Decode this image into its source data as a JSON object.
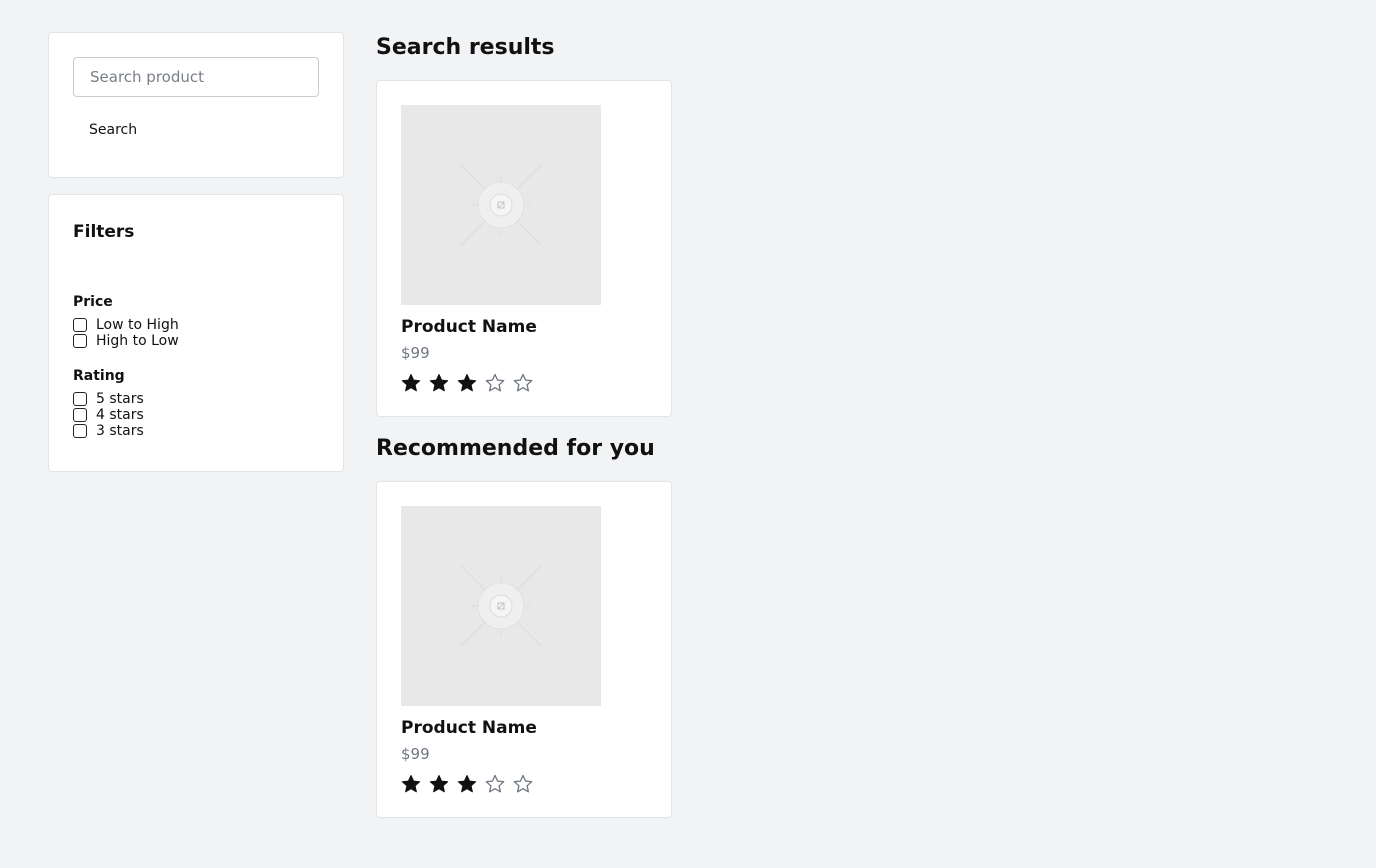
{
  "search": {
    "placeholder": "Search product",
    "value": "",
    "button_label": "Search"
  },
  "filters": {
    "title": "Filters",
    "price": {
      "title": "Price",
      "options": [
        "Low to High",
        "High to Low"
      ]
    },
    "rating": {
      "title": "Rating",
      "options": [
        "5 stars",
        "4 stars",
        "3 stars"
      ]
    }
  },
  "sections": {
    "search_results": {
      "title": "Search results",
      "product": {
        "name": "Product Name",
        "price": "$99",
        "rating": 3,
        "max_rating": 5,
        "image_icon": "image-placeholder-icon"
      }
    },
    "recommended": {
      "title": "Recommended for you",
      "product": {
        "name": "Product Name",
        "price": "$99",
        "rating": 3,
        "max_rating": 5,
        "image_icon": "image-placeholder-icon"
      }
    }
  },
  "colors": {
    "background": "#f2f3f5",
    "star_filled": "#111111",
    "star_empty_stroke": "#6f7680",
    "price_text": "#6f7680",
    "image_placeholder": "#e8e8e8"
  }
}
